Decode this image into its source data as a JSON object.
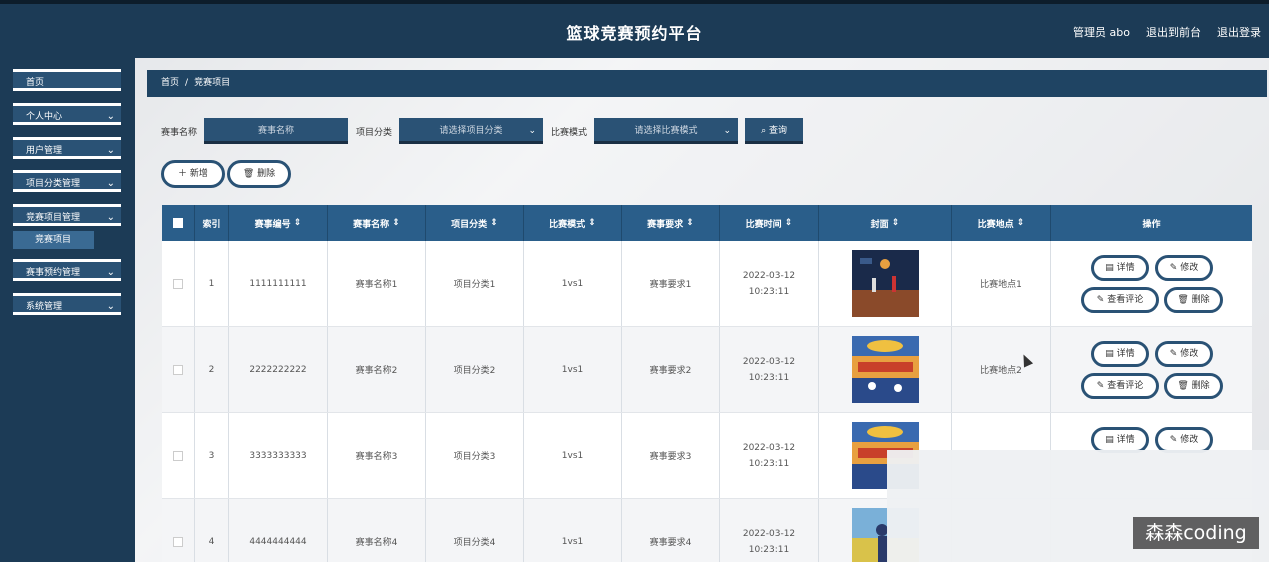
{
  "app": {
    "title": "篮球竞赛预约平台"
  },
  "header": {
    "admin": "管理员 abo",
    "front": "退出到前台",
    "logout": "退出登录"
  },
  "sidebar": {
    "items": [
      {
        "label": "首页",
        "chevron": ""
      },
      {
        "label": "个人中心",
        "chevron": "⌄"
      },
      {
        "label": "用户管理",
        "chevron": "⌄"
      },
      {
        "label": "项目分类管理",
        "chevron": "⌄"
      },
      {
        "label": "竞赛项目管理",
        "chevron": "⌄"
      },
      {
        "label": "赛事预约管理",
        "chevron": "⌄"
      },
      {
        "label": "系统管理",
        "chevron": "⌄"
      }
    ],
    "sub_item": "竞赛项目"
  },
  "breadcrumb": {
    "home": "首页",
    "sep": "/",
    "current": "竞赛项目"
  },
  "search": {
    "name_label": "赛事名称",
    "name_placeholder": "赛事名称",
    "category_label": "项目分类",
    "category_placeholder": "请选择项目分类",
    "mode_label": "比赛模式",
    "mode_placeholder": "请选择比赛模式",
    "query_button": "查询"
  },
  "actions": {
    "add": "新增",
    "delete": "删除"
  },
  "table": {
    "headers": [
      "索引",
      "赛事编号",
      "赛事名称",
      "项目分类",
      "比赛模式",
      "赛事要求",
      "比赛时间",
      "封面",
      "比赛地点",
      "操作"
    ],
    "rows": [
      {
        "index": "1",
        "code": "1111111111",
        "name": "赛事名称1",
        "category": "项目分类1",
        "mode": "1vs1",
        "req": "赛事要求1",
        "time": "2022-03-12 10:23:11",
        "location": "比赛地点1"
      },
      {
        "index": "2",
        "code": "2222222222",
        "name": "赛事名称2",
        "category": "项目分类2",
        "mode": "1vs1",
        "req": "赛事要求2",
        "time": "2022-03-12 10:23:11",
        "location": "比赛地点2"
      },
      {
        "index": "3",
        "code": "3333333333",
        "name": "赛事名称3",
        "category": "项目分类3",
        "mode": "1vs1",
        "req": "赛事要求3",
        "time": "2022-03-12 10:23:11",
        "location": ""
      },
      {
        "index": "4",
        "code": "4444444444",
        "name": "赛事名称4",
        "category": "项目分类4",
        "mode": "1vs1",
        "req": "赛事要求4",
        "time": "2022-03-12 10:23:11",
        "location": ""
      }
    ],
    "op_labels": {
      "detail": "详情",
      "edit": "修改",
      "comments": "查看评论",
      "delete": "删除"
    }
  },
  "watermark": "森森coding",
  "colors": {
    "primary": "#2a5275",
    "header": "#1c3b56",
    "table_header": "#2a5e8a"
  }
}
